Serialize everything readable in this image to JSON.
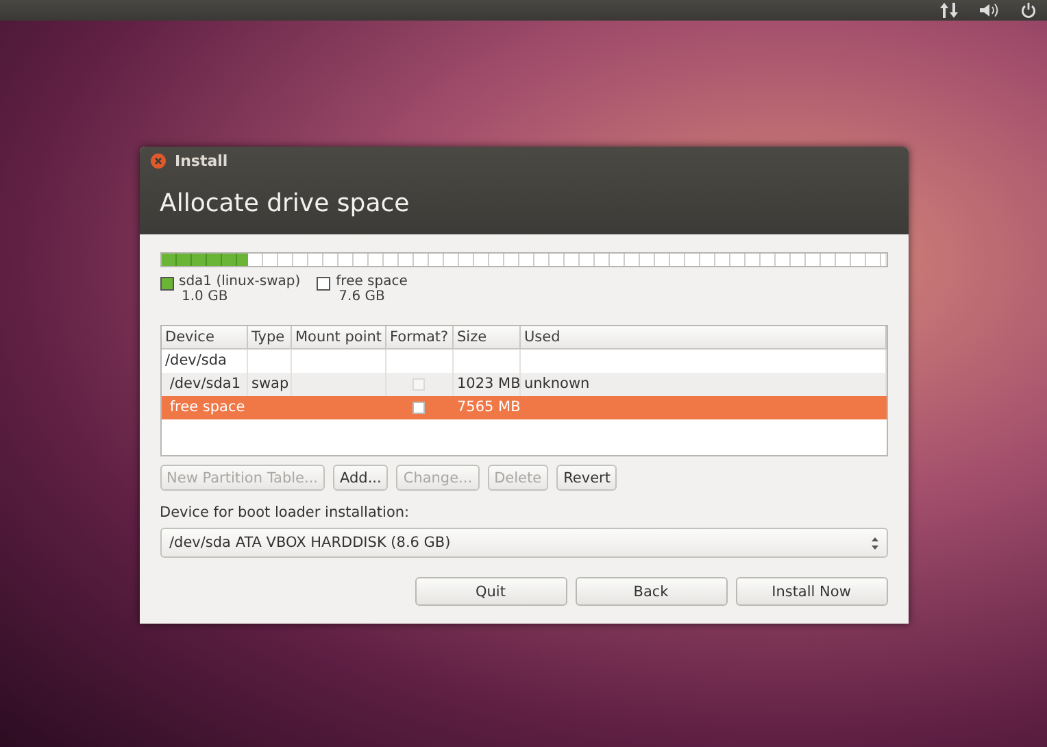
{
  "window": {
    "title": "Install",
    "heading": "Allocate drive space"
  },
  "partition_bar": {
    "segments": [
      {
        "label": "sda1 (linux-swap)",
        "size": "1.0 GB",
        "color": "#6ab536",
        "level": 0.12
      },
      {
        "label": "free space",
        "size": "7.6 GB",
        "color": "#ffffff",
        "level": 0.88
      }
    ]
  },
  "table": {
    "columns": [
      "Device",
      "Type",
      "Mount point",
      "Format?",
      "Size",
      "Used"
    ],
    "rows": [
      {
        "device": "/dev/sda",
        "type": "",
        "mount": "",
        "format": null,
        "size": "",
        "used": "",
        "selected": false
      },
      {
        "device": " /dev/sda1",
        "type": "swap",
        "mount": "",
        "format": {
          "checked": false,
          "disabled": true
        },
        "size": "1023 MB",
        "used": "unknown",
        "selected": false
      },
      {
        "device": " free space",
        "type": "",
        "mount": "",
        "format": {
          "checked": false,
          "disabled": false
        },
        "size": "7565 MB",
        "used": "",
        "selected": true
      }
    ]
  },
  "partition_buttons": [
    {
      "label": "New Partition Table...",
      "disabled": true
    },
    {
      "label": "Add...",
      "disabled": false
    },
    {
      "label": "Change...",
      "disabled": true
    },
    {
      "label": "Delete",
      "disabled": true
    },
    {
      "label": "Revert",
      "disabled": false
    }
  ],
  "boot_loader": {
    "label": "Device for boot loader installation:",
    "value": "/dev/sda ATA VBOX HARDDISK (8.6 GB)"
  },
  "buttons": [
    "Quit",
    "Back",
    "Install Now"
  ]
}
